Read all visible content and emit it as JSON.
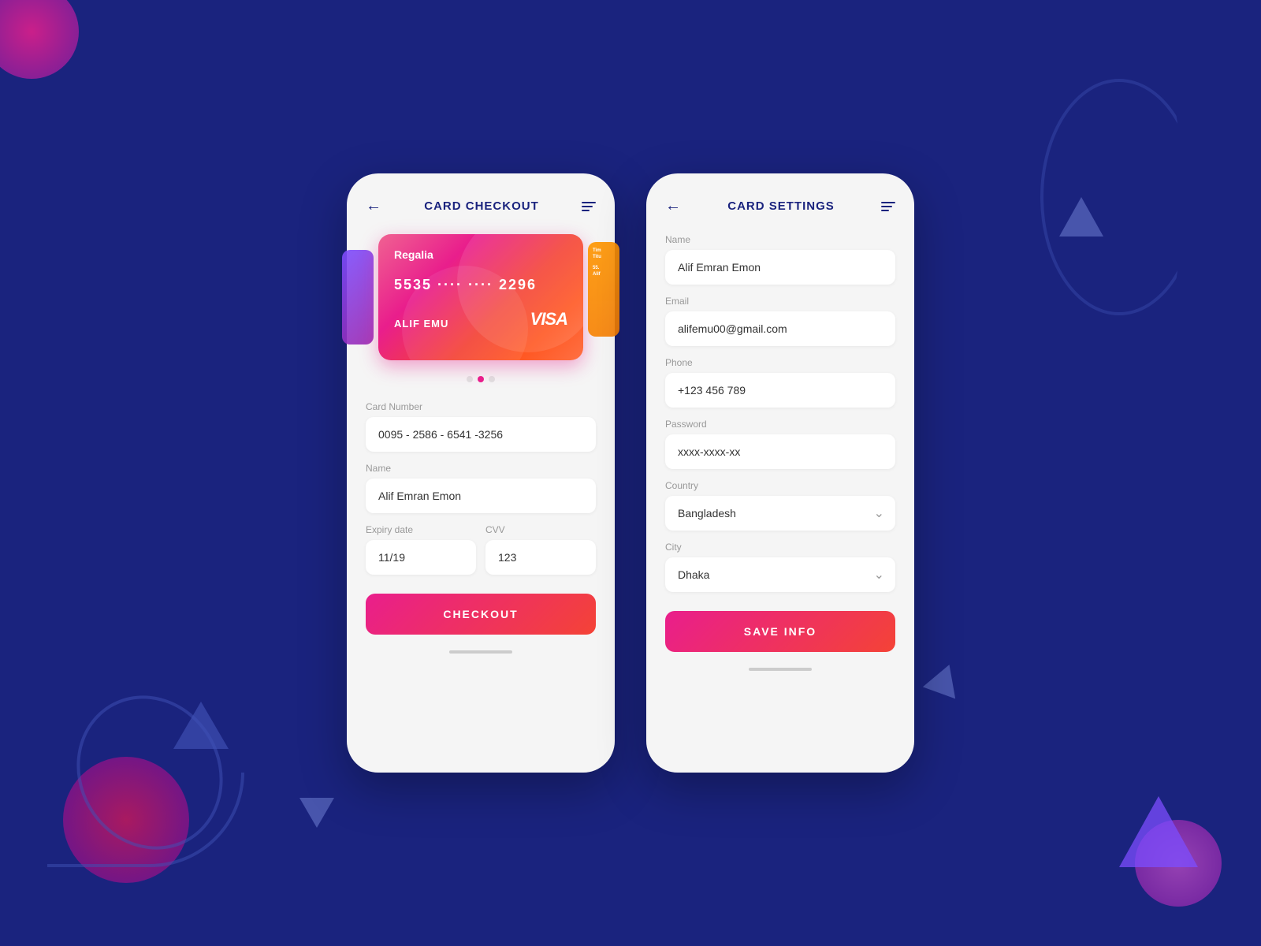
{
  "background": {
    "color": "#1a237e"
  },
  "screen_left": {
    "title": "CARD CHECKOUT",
    "card": {
      "brand": "Regalia",
      "number": "5535  ····  ····  2296",
      "holder": "ALIF EMU",
      "network": "VISA"
    },
    "form": {
      "card_number_label": "Card Number",
      "card_number_value": "0095 - 2586 - 6541 -3256",
      "name_label": "Name",
      "name_value": "Alif Emran Emon",
      "expiry_label": "Expiry date",
      "expiry_value": "11/19",
      "cvv_label": "CVV",
      "cvv_value": "123"
    },
    "checkout_button": "CHECKOUT"
  },
  "screen_right": {
    "title": "CARD SETTINGS",
    "form": {
      "name_label": "Name",
      "name_value": "Alif Emran Emon",
      "email_label": "Email",
      "email_value": "alifemu00@gmail.com",
      "phone_label": "Phone",
      "phone_value": "+123 456 789",
      "password_label": "Password",
      "password_value": "xxxx-xxxx-xx",
      "country_label": "Country",
      "country_value": "Bangladesh",
      "city_label": "City",
      "city_value": "Dhaka"
    },
    "save_button": "SAVE INFO"
  }
}
